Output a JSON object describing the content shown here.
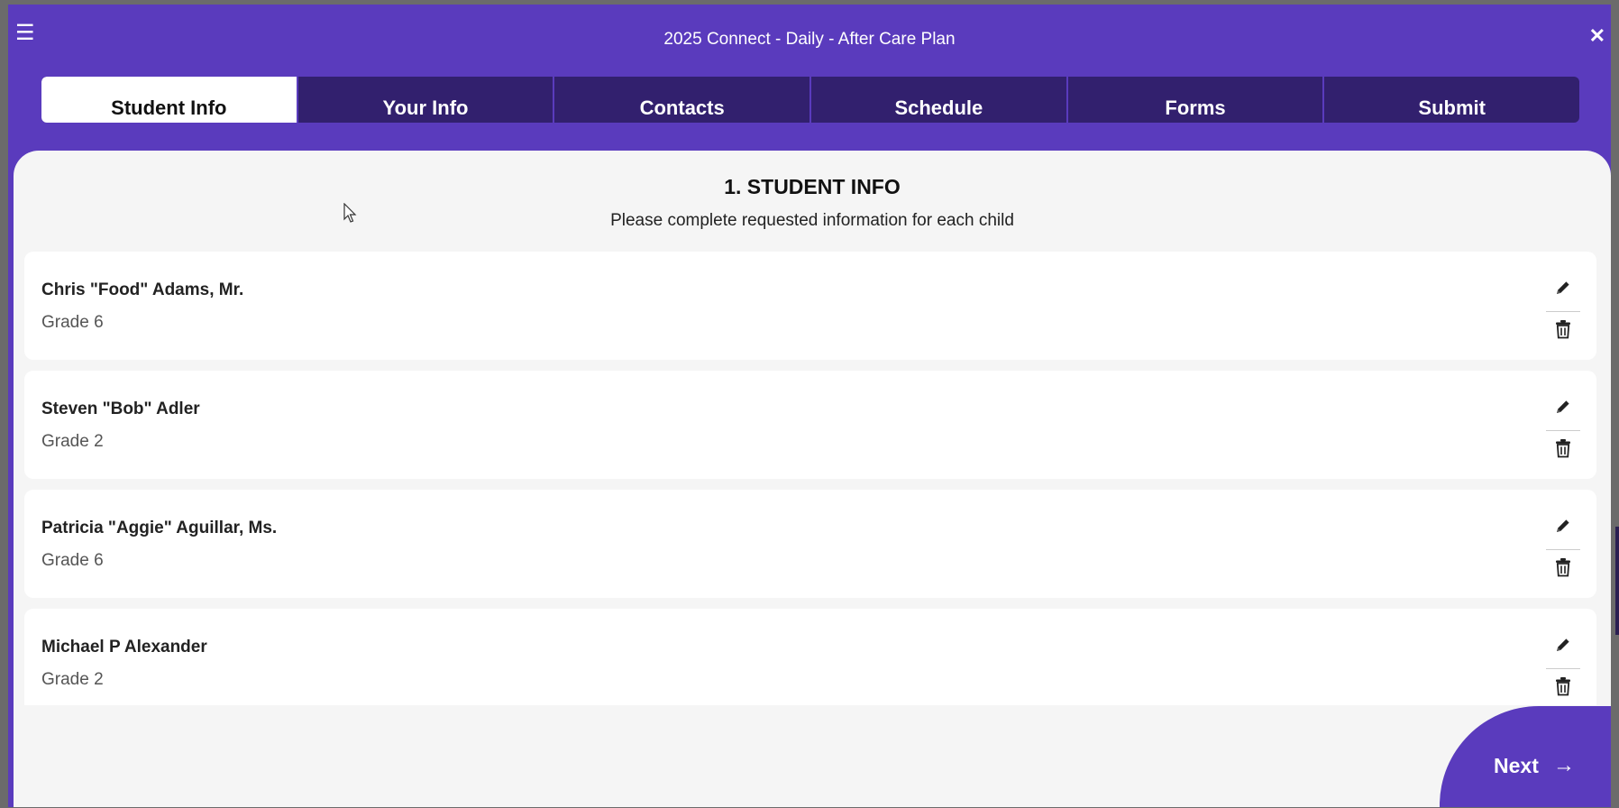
{
  "window": {
    "title": "2025 Connect - Daily - After Care Plan",
    "menu_icon": "☰",
    "close_icon": "✕"
  },
  "tabs": [
    {
      "label": "Student Info",
      "active": true
    },
    {
      "label": "Your Info"
    },
    {
      "label": "Contacts"
    },
    {
      "label": "Schedule"
    },
    {
      "label": "Forms"
    },
    {
      "label": "Submit"
    }
  ],
  "section": {
    "title": "1. STUDENT INFO",
    "subtitle": "Please complete requested information for each child"
  },
  "students": [
    {
      "name": "Chris \"Food\" Adams, Mr.",
      "grade": "Grade 6"
    },
    {
      "name": "Steven \"Bob\" Adler",
      "grade": "Grade 2"
    },
    {
      "name": "Patricia \"Aggie\" Aguillar, Ms.",
      "grade": "Grade 6"
    },
    {
      "name": "Michael P Alexander",
      "grade": "Grade 2"
    }
  ],
  "next_button": {
    "label": "Next",
    "arrow": "→"
  },
  "icons": {
    "edit": "pencil-icon",
    "delete": "trash-icon"
  },
  "colors": {
    "primary": "#5a3bbd",
    "tab_bg": "#32206e",
    "panel_bg": "#f5f5f5"
  }
}
